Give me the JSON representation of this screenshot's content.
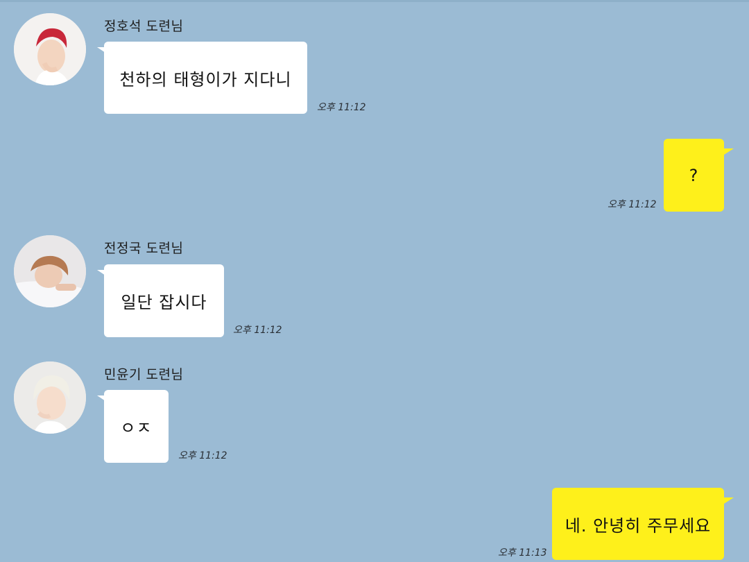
{
  "chat": {
    "messages": [
      {
        "sender": "정호석 도련님",
        "text": "천하의 태형이가 지다니",
        "time": "오후 11:12",
        "direction": "incoming",
        "avatar": "member-hoseok-avatar"
      },
      {
        "sender": "",
        "text": "?",
        "time": "오후 11:12",
        "direction": "outgoing"
      },
      {
        "sender": "전정국 도련님",
        "text": "일단 잡시다",
        "time": "오후 11:12",
        "direction": "incoming",
        "avatar": "member-jungkook-avatar"
      },
      {
        "sender": "민윤기 도련님",
        "text": "ㅇㅈ",
        "time": "오후 11:12",
        "direction": "incoming",
        "avatar": "member-yoongi-avatar"
      },
      {
        "sender": "",
        "text": "네. 안녕히 주무세요",
        "time": "오후 11:13",
        "direction": "outgoing"
      }
    ]
  },
  "colors": {
    "background": "#9bbbd4",
    "incoming_bubble": "#ffffff",
    "outgoing_bubble": "#fef01b",
    "text": "#111111"
  }
}
